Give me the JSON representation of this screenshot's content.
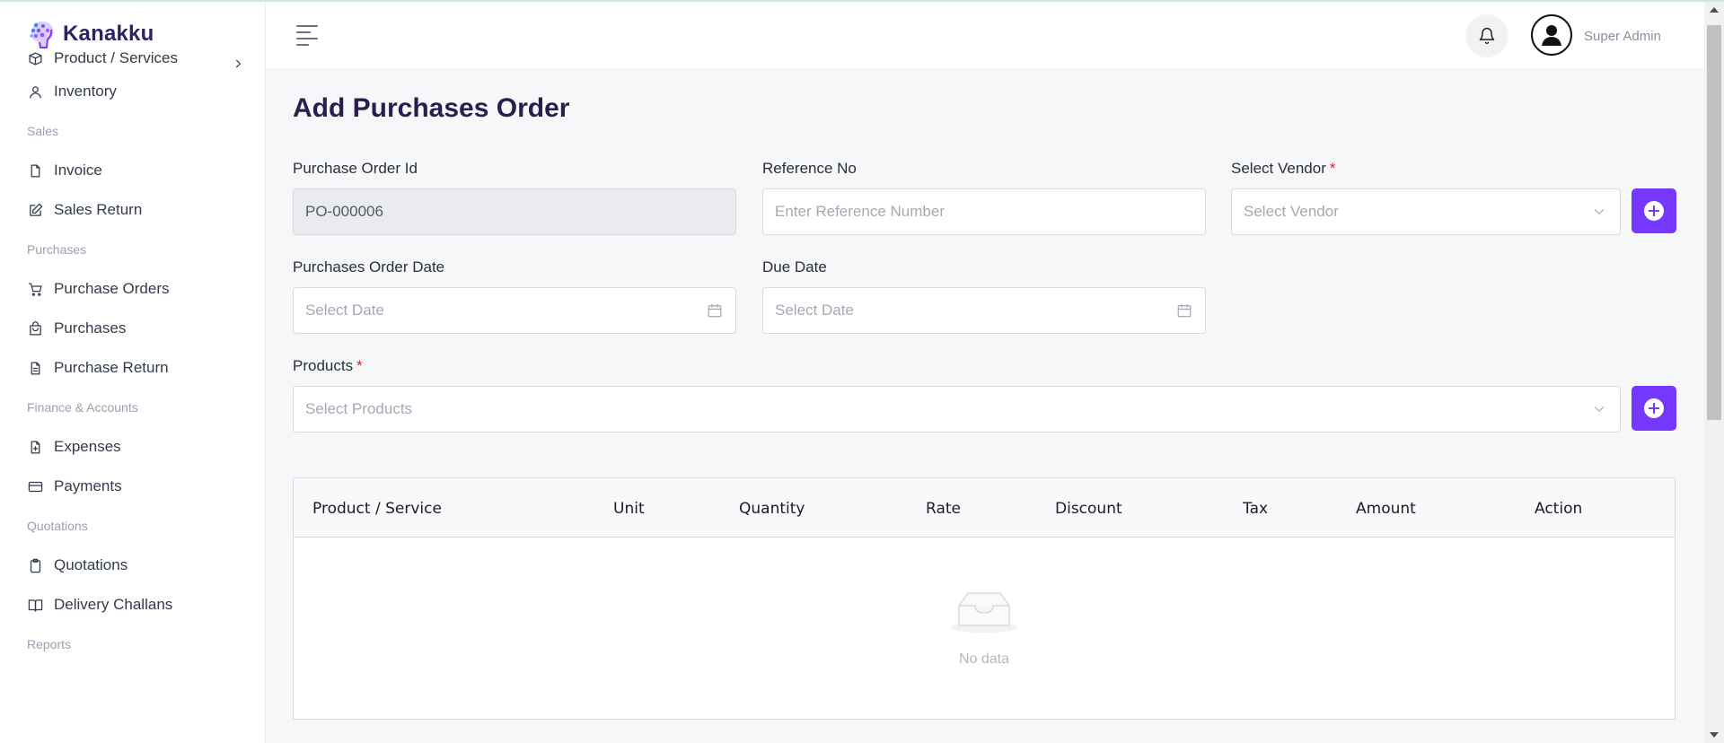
{
  "app": {
    "name": "Kanakku"
  },
  "sidebar": {
    "items": [
      {
        "type": "item",
        "label": "Product / Services",
        "icon": "box-icon",
        "has_submenu": true,
        "cut": true
      },
      {
        "type": "item",
        "label": "Inventory",
        "icon": "user-icon"
      },
      {
        "type": "section",
        "label": "Sales"
      },
      {
        "type": "item",
        "label": "Invoice",
        "icon": "file-icon"
      },
      {
        "type": "item",
        "label": "Sales Return",
        "icon": "edit-icon"
      },
      {
        "type": "section",
        "label": "Purchases"
      },
      {
        "type": "item",
        "label": "Purchase Orders",
        "icon": "cart-icon"
      },
      {
        "type": "item",
        "label": "Purchases",
        "icon": "bag-icon"
      },
      {
        "type": "item",
        "label": "Purchase Return",
        "icon": "file-text-icon"
      },
      {
        "type": "section",
        "label": "Finance & Accounts"
      },
      {
        "type": "item",
        "label": "Expenses",
        "icon": "file-plus-icon"
      },
      {
        "type": "item",
        "label": "Payments",
        "icon": "credit-card-icon"
      },
      {
        "type": "section",
        "label": "Quotations"
      },
      {
        "type": "item",
        "label": "Quotations",
        "icon": "clipboard-icon"
      },
      {
        "type": "item",
        "label": "Delivery Challans",
        "icon": "book-icon"
      },
      {
        "type": "section",
        "label": "Reports"
      }
    ]
  },
  "header": {
    "user_name": "Super Admin"
  },
  "main": {
    "title": "Add Purchases Order",
    "fields": {
      "po_id": {
        "label": "Purchase Order Id",
        "value": "PO-000006"
      },
      "reference": {
        "label": "Reference No",
        "placeholder": "Enter Reference Number"
      },
      "vendor": {
        "label": "Select Vendor",
        "placeholder": "Select Vendor",
        "required": "*"
      },
      "po_date": {
        "label": "Purchases Order Date",
        "placeholder": "Select Date"
      },
      "due_date": {
        "label": "Due Date",
        "placeholder": "Select Date"
      },
      "products": {
        "label": "Products",
        "placeholder": "Select Products",
        "required": "*"
      }
    },
    "table": {
      "columns": [
        "Product / Service",
        "Unit",
        "Quantity",
        "Rate",
        "Discount",
        "Tax",
        "Amount",
        "Action"
      ],
      "empty_text": "No data"
    }
  },
  "colors": {
    "accent": "#7638ff",
    "title": "#2c1d4f",
    "required": "#e0242c"
  }
}
